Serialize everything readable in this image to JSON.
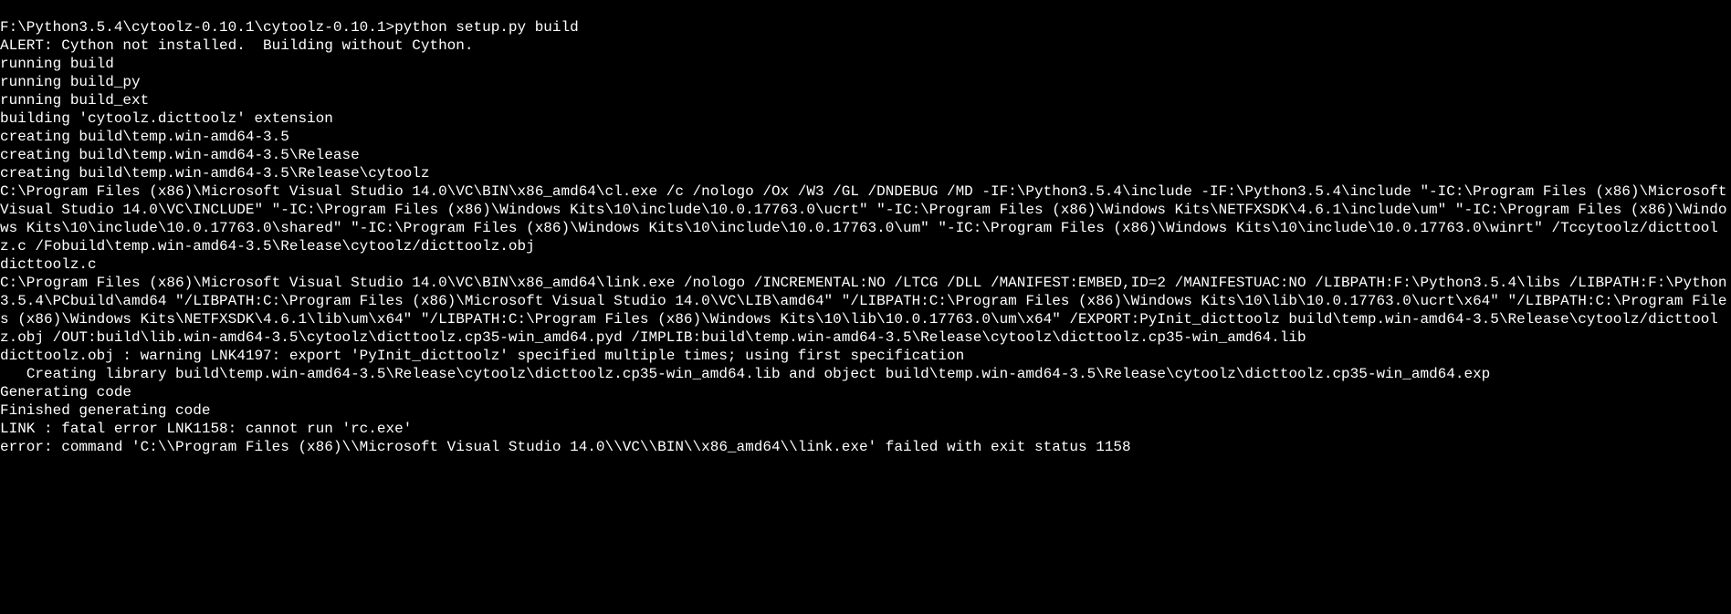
{
  "terminal": {
    "prompt_line": "F:\\Python3.5.4\\cytoolz-0.10.1\\cytoolz-0.10.1>python setup.py build",
    "lines": [
      "ALERT: Cython not installed.  Building without Cython.",
      "running build",
      "running build_py",
      "running build_ext",
      "building 'cytoolz.dicttoolz' extension",
      "creating build\\temp.win-amd64-3.5",
      "creating build\\temp.win-amd64-3.5\\Release",
      "creating build\\temp.win-amd64-3.5\\Release\\cytoolz",
      "C:\\Program Files (x86)\\Microsoft Visual Studio 14.0\\VC\\BIN\\x86_amd64\\cl.exe /c /nologo /Ox /W3 /GL /DNDEBUG /MD -IF:\\Python3.5.4\\include -IF:\\Python3.5.4\\include \"-IC:\\Program Files (x86)\\Microsoft Visual Studio 14.0\\VC\\INCLUDE\" \"-IC:\\Program Files (x86)\\Windows Kits\\10\\include\\10.0.17763.0\\ucrt\" \"-IC:\\Program Files (x86)\\Windows Kits\\NETFXSDK\\4.6.1\\include\\um\" \"-IC:\\Program Files (x86)\\Windows Kits\\10\\include\\10.0.17763.0\\shared\" \"-IC:\\Program Files (x86)\\Windows Kits\\10\\include\\10.0.17763.0\\um\" \"-IC:\\Program Files (x86)\\Windows Kits\\10\\include\\10.0.17763.0\\winrt\" /Tccytoolz/dicttoolz.c /Fobuild\\temp.win-amd64-3.5\\Release\\cytoolz/dicttoolz.obj",
      "dicttoolz.c",
      "C:\\Program Files (x86)\\Microsoft Visual Studio 14.0\\VC\\BIN\\x86_amd64\\link.exe /nologo /INCREMENTAL:NO /LTCG /DLL /MANIFEST:EMBED,ID=2 /MANIFESTUAC:NO /LIBPATH:F:\\Python3.5.4\\libs /LIBPATH:F:\\Python3.5.4\\PCbuild\\amd64 \"/LIBPATH:C:\\Program Files (x86)\\Microsoft Visual Studio 14.0\\VC\\LIB\\amd64\" \"/LIBPATH:C:\\Program Files (x86)\\Windows Kits\\10\\lib\\10.0.17763.0\\ucrt\\x64\" \"/LIBPATH:C:\\Program Files (x86)\\Windows Kits\\NETFXSDK\\4.6.1\\lib\\um\\x64\" \"/LIBPATH:C:\\Program Files (x86)\\Windows Kits\\10\\lib\\10.0.17763.0\\um\\x64\" /EXPORT:PyInit_dicttoolz build\\temp.win-amd64-3.5\\Release\\cytoolz/dicttoolz.obj /OUT:build\\lib.win-amd64-3.5\\cytoolz\\dicttoolz.cp35-win_amd64.pyd /IMPLIB:build\\temp.win-amd64-3.5\\Release\\cytoolz\\dicttoolz.cp35-win_amd64.lib",
      "dicttoolz.obj : warning LNK4197: export 'PyInit_dicttoolz' specified multiple times; using first specification",
      "   Creating library build\\temp.win-amd64-3.5\\Release\\cytoolz\\dicttoolz.cp35-win_amd64.lib and object build\\temp.win-amd64-3.5\\Release\\cytoolz\\dicttoolz.cp35-win_amd64.exp",
      "Generating code",
      "Finished generating code",
      "LINK : fatal error LNK1158: cannot run 'rc.exe'",
      "error: command 'C:\\\\Program Files (x86)\\\\Microsoft Visual Studio 14.0\\\\VC\\\\BIN\\\\x86_amd64\\\\link.exe' failed with exit status 1158"
    ]
  }
}
